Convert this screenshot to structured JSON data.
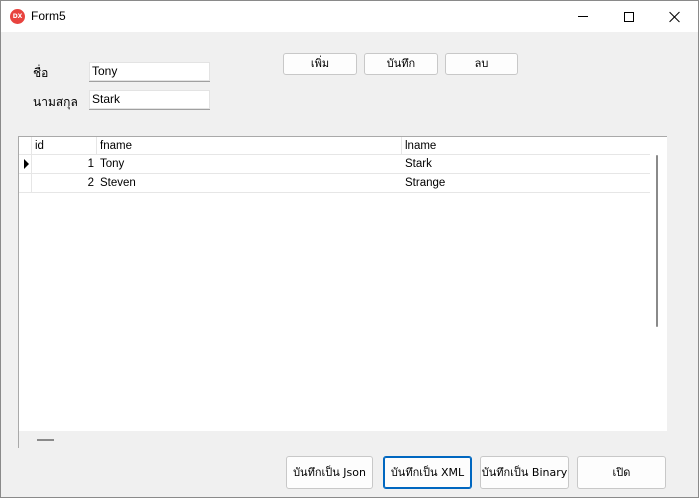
{
  "window": {
    "title": "Form5",
    "app_icon_text": "DX"
  },
  "form": {
    "first_name": {
      "label": "ชื่อ",
      "value": "Tony"
    },
    "last_name": {
      "label": "นามสกุล",
      "value": "Stark"
    }
  },
  "buttons": {
    "add": "เพิ่ม",
    "save": "บันทึก",
    "delete": "ลบ",
    "save_json": "บันทึกเป็น Json",
    "save_xml": "บันทึกเป็น XML",
    "save_binary": "บันทึกเป็น Binary",
    "open": "เปิด"
  },
  "grid": {
    "columns": [
      "id",
      "fname",
      "lname"
    ],
    "rows": [
      {
        "id": "1",
        "fname": "Tony",
        "lname": "Stark"
      },
      {
        "id": "2",
        "fname": "Steven",
        "lname": "Strange"
      }
    ]
  }
}
